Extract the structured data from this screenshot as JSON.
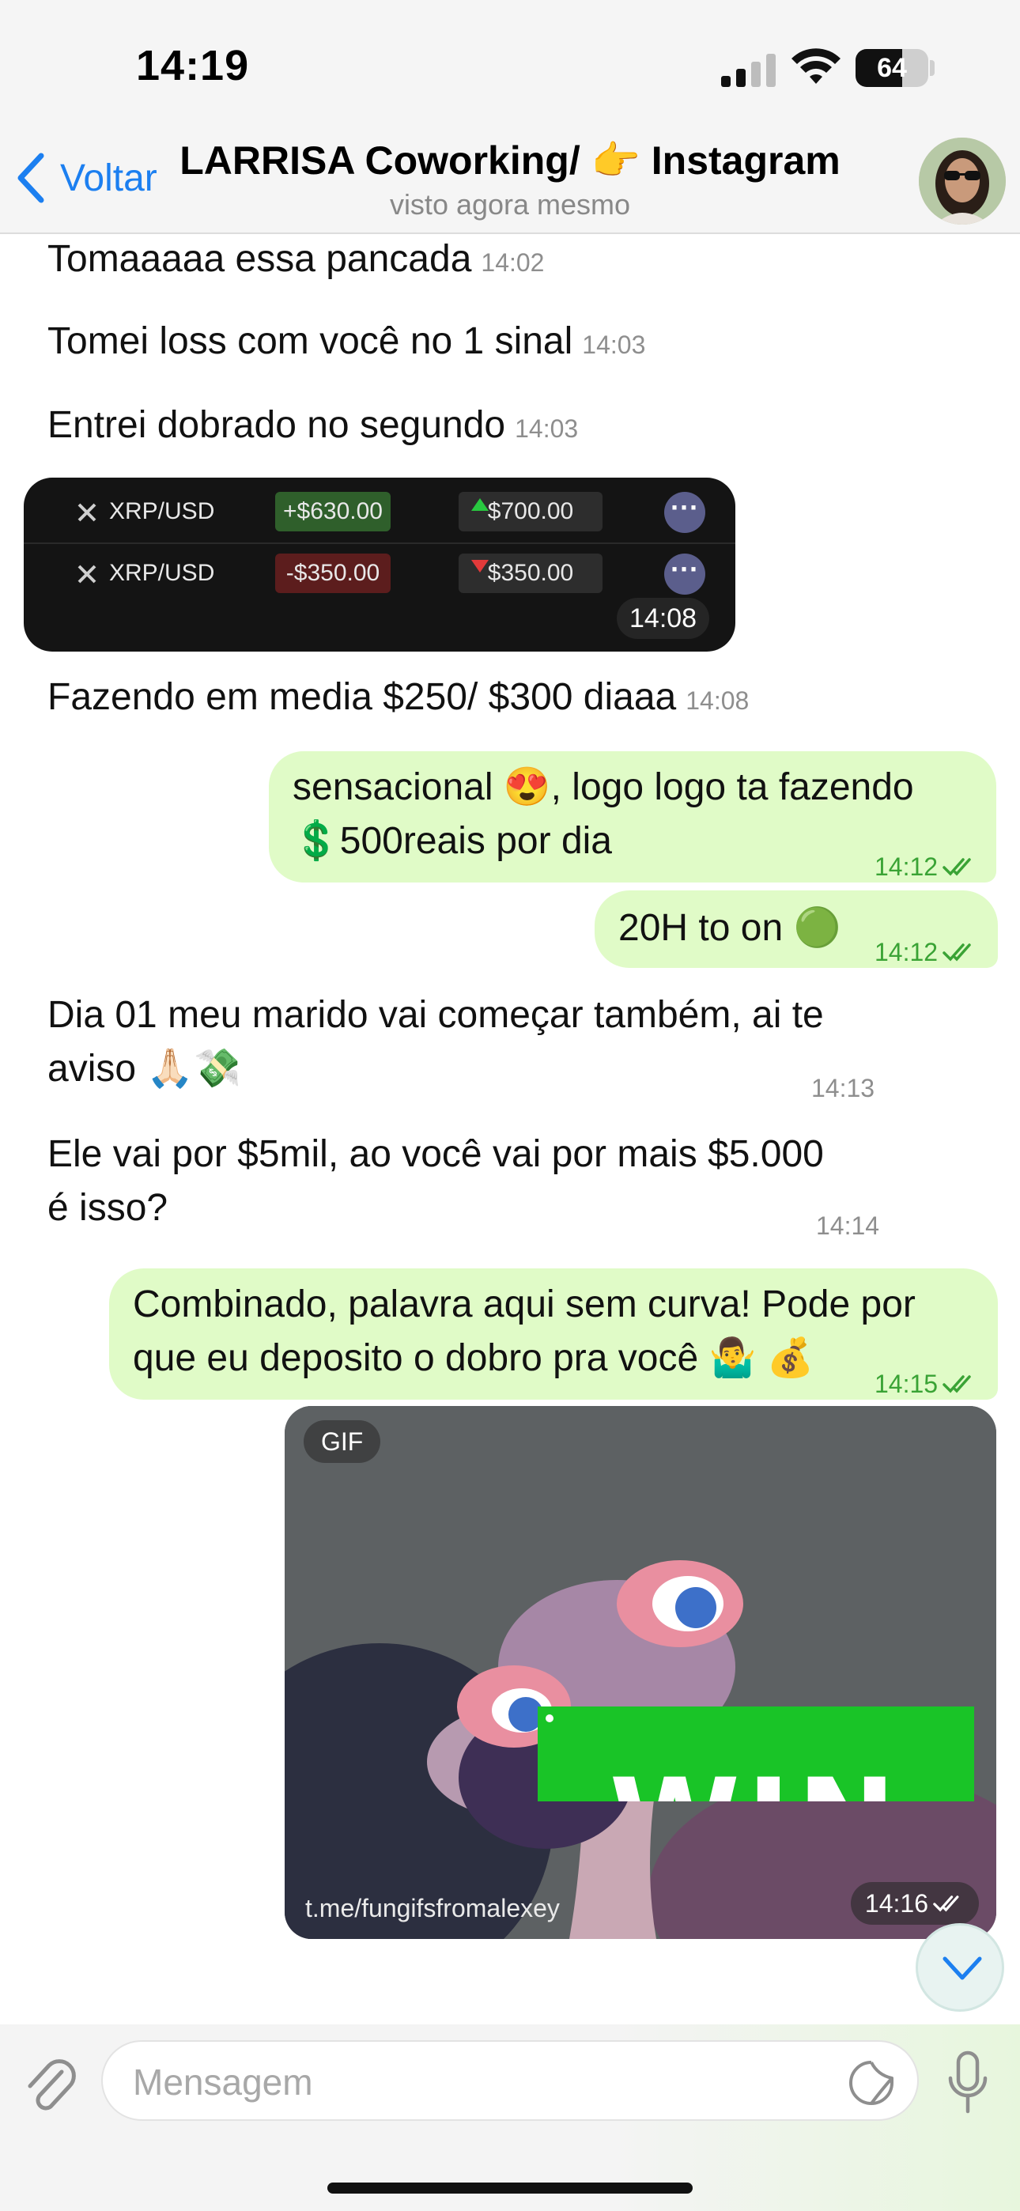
{
  "status_bar": {
    "time": "14:19",
    "battery_level": "64"
  },
  "header": {
    "back_label": "Voltar",
    "title": "LARRISA Coworking/ 👉 Instagram",
    "subtitle": "visto agora mesmo"
  },
  "messages": [
    {
      "text": "Tomaaaaa essa pancada",
      "time": "14:02"
    },
    {
      "text": "Tomei loss com você no 1 sinal",
      "time": "14:03"
    },
    {
      "text": "Entrei dobrado no segundo",
      "time": "14:03"
    },
    {
      "text": "Fazendo em media $250/ $300 diaaa",
      "time": "14:08"
    },
    {
      "line1": "sensacional 😍, logo logo ta fazendo",
      "line2": "💲500reais por dia",
      "time": "14:12"
    },
    {
      "text": "20H to on 🟢",
      "time": "14:12"
    },
    {
      "line1": "Dia 01 meu marido vai começar também, ai te",
      "line2": "aviso 🙏🏻💸",
      "time": "14:13"
    },
    {
      "line1": "Ele vai por $5mil, ao você vai por mais $5.000",
      "line2": "é isso?",
      "time": "14:14"
    },
    {
      "line1": "Combinado, palavra aqui sem curva! Pode por",
      "line2": "que eu deposito o dobro pra você 🤷‍♂️ 💰",
      "time": "14:15"
    }
  ],
  "trade_image": {
    "rows": [
      {
        "pair": "XRP/USD",
        "pnl": "+$630.00",
        "price": "$700.00",
        "direction": "up",
        "pnl_color": "#2f5f2b"
      },
      {
        "pair": "XRP/USD",
        "pnl": "-$350.00",
        "price": "$350.00",
        "direction": "down",
        "pnl_color": "#5c1d1d"
      }
    ],
    "time": "14:08"
  },
  "gif": {
    "badge": "GIF",
    "watermark": "t.me/fungifsfromalexey",
    "time": "14:16"
  },
  "win_image": {
    "text": "WIN"
  },
  "composer": {
    "placeholder": "Mensagem"
  },
  "colors": {
    "accent_blue": "#1c7ff0",
    "outgoing_bubble": "#e0fbc7",
    "read_check": "#3aa335"
  }
}
